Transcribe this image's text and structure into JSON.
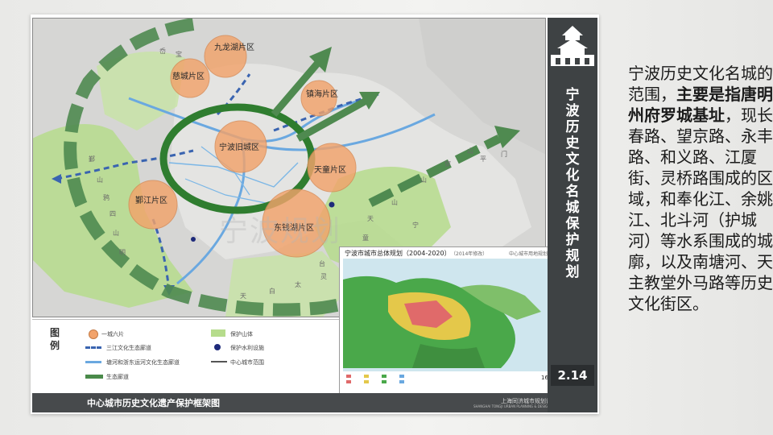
{
  "panel": {
    "side_title": [
      "宁",
      "波",
      "历",
      "史",
      "文",
      "化",
      "名",
      "城",
      "保",
      "护",
      "规",
      "划"
    ],
    "page_number": "2.14",
    "footer_title": "中心城市历史文化遗产保护框架图",
    "footer_org": "上海同济城市规划设计研究院",
    "footer_org_en": "SHANGHAI TONGJI URBAN PLANNING & DESIGN INSTITUTE"
  },
  "map": {
    "zones": [
      {
        "name": "九龙湖片区"
      },
      {
        "name": "慈城片区"
      },
      {
        "name": "镇海片区"
      },
      {
        "name": "宁波旧城区"
      },
      {
        "name": "天童片区"
      },
      {
        "name": "鄞江片区"
      },
      {
        "name": "东钱湖片区"
      }
    ],
    "ring_characters": [
      "岙",
      "宝",
      "鄞",
      "山",
      "鸦",
      "山",
      "四",
      "明",
      "山",
      "天",
      "童",
      "山",
      "灵",
      "太",
      "白",
      "天",
      "台",
      "山",
      "穿",
      "山",
      "平",
      "门",
      "宁"
    ],
    "watermark": "宁波规划"
  },
  "legend": {
    "title": "图例",
    "items": [
      {
        "label": "一城六片",
        "color": "#f2a36b",
        "icon": "circle-swatch"
      },
      {
        "label": "保护山体",
        "color": "#b6dc8c",
        "icon": "rect-swatch"
      },
      {
        "label": "三江文化生态廊道",
        "color": "#3a64b0",
        "icon": "dashed-arrow-swatch"
      },
      {
        "label": "保护水利设施",
        "color": "#1e2a7a",
        "icon": "dot-swatch"
      },
      {
        "label": "塘河和浙东运河文化生态廊道",
        "color": "#6aa8e0",
        "icon": "river-swatch"
      },
      {
        "label": "中心城市范围",
        "color": "#555555",
        "icon": "boundary-swatch"
      },
      {
        "label": "生态廊道",
        "color": "#4a8a4a",
        "icon": "green-corridor-swatch"
      }
    ]
  },
  "inset": {
    "title": "宁波市城市总体规划（2004-2020）",
    "subtitle": "（2014年修改）",
    "right_label": "中心城市用地规划图",
    "page": "16"
  },
  "side_text": {
    "part1": "宁波历史文化名城的范围，",
    "bold": "主要是指唐明州府罗城基址",
    "part2": "，现长春路、望京路、永丰路、和义路、江厦街、灵桥路围成的区域，和奉化江、余姚江、北斗河（护城河）等水系围成的城廓，以及南塘河、天主教堂外马路等历史文化街区。"
  },
  "colors": {
    "zone_fill": "#f2a36b",
    "mountain_green": "#b6dc8c",
    "corridor_green": "#4f8a50",
    "city_ring": "#2f7d2f",
    "river_blue": "#3a64b0",
    "side_bar": "#3e4244"
  }
}
